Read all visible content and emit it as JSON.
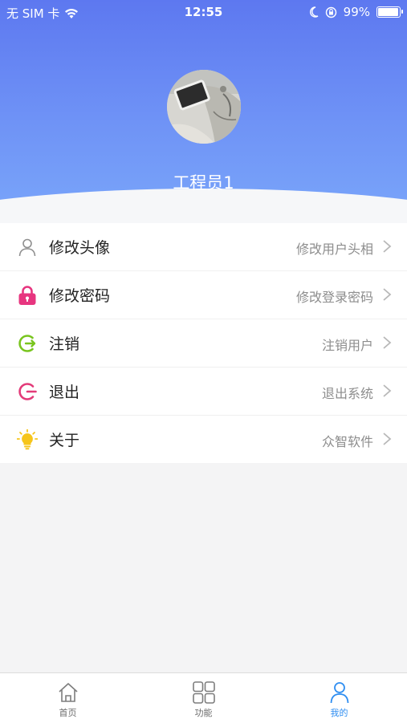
{
  "status_bar": {
    "carrier": "无 SIM 卡",
    "time": "12:55",
    "battery": "99%"
  },
  "profile": {
    "username": "工程员1"
  },
  "menu": {
    "items": [
      {
        "title": "修改头像",
        "subtitle": "修改用户头相",
        "icon": "user-outline-icon"
      },
      {
        "title": "修改密码",
        "subtitle": "修改登录密码",
        "icon": "lock-icon"
      },
      {
        "title": "注销",
        "subtitle": "注销用户",
        "icon": "logout-green-icon"
      },
      {
        "title": "退出",
        "subtitle": "退出系统",
        "icon": "exit-pink-icon"
      },
      {
        "title": "关于",
        "subtitle": "众智软件",
        "icon": "lightbulb-icon"
      }
    ]
  },
  "tabbar": {
    "tabs": [
      {
        "label": "首页",
        "icon": "home-icon"
      },
      {
        "label": "功能",
        "icon": "grid-icon"
      },
      {
        "label": "我的",
        "icon": "person-icon"
      }
    ],
    "active_tab": "我的"
  },
  "colors": {
    "header_top": "#5d78f0",
    "header_bottom": "#7aa6fa",
    "accent_blue": "#2f8ef1",
    "lock_pink": "#e7357f",
    "logout_green": "#79c51f",
    "exit_pink": "#e33b79",
    "bulb_yellow": "#f6c51b"
  }
}
